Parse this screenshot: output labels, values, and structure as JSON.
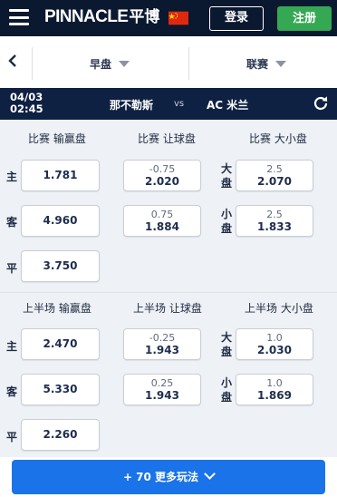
{
  "header": {
    "logo_text": "PINNACLE",
    "logo_cn": "平博",
    "login_label": "登录",
    "register_label": "注册",
    "flag": "china-flag-icon",
    "colors": {
      "bar": "#0a1830",
      "register": "#34a853"
    }
  },
  "filters": {
    "early_label": "早盘",
    "league_label": "联赛"
  },
  "match": {
    "date": "04/03",
    "time": "02:45",
    "home": "那不勒斯",
    "vs": "vs",
    "away": "AC 米兰"
  },
  "full_time": {
    "moneyline_title": "比赛 输赢盘",
    "handicap_title": "比赛 让球盘",
    "total_title": "比赛 大小盘",
    "rows": {
      "home_label": "主",
      "away_label": "客",
      "draw_label": "平"
    },
    "moneyline": {
      "home": "1.781",
      "away": "4.960",
      "draw": "3.750"
    },
    "handicap": [
      {
        "line": "-0.75",
        "price": "2.020"
      },
      {
        "line": "0.75",
        "price": "1.884"
      }
    ],
    "total": [
      {
        "label": "大盘",
        "line": "2.5",
        "price": "2.070"
      },
      {
        "label": "小盘",
        "line": "2.5",
        "price": "1.833"
      }
    ]
  },
  "first_half": {
    "moneyline_title": "上半场 输赢盘",
    "handicap_title": "上半场 让球盘",
    "total_title": "上半场 大小盘",
    "moneyline": {
      "home": "2.470",
      "away": "5.330",
      "draw": "2.260"
    },
    "handicap": [
      {
        "line": "-0.25",
        "price": "1.943"
      },
      {
        "line": "0.25",
        "price": "1.943"
      }
    ],
    "total": [
      {
        "label": "大盘",
        "line": "1.0",
        "price": "2.030"
      },
      {
        "label": "小盘",
        "line": "1.0",
        "price": "1.869"
      }
    ]
  },
  "more_button": {
    "label": "+ 70 更多玩法",
    "color": "#1a73e8"
  }
}
